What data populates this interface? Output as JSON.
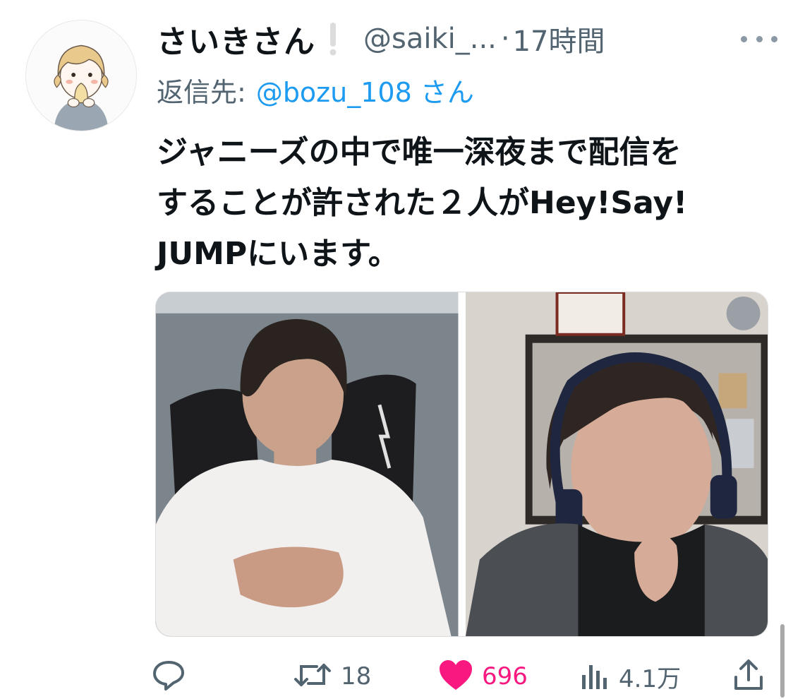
{
  "tweet": {
    "author_name": "さいきさん",
    "handle": "@saiki_...",
    "separator": "·",
    "time": "17時間",
    "reply_prefix": "返信先:",
    "reply_mention": "@bozu_108 さん",
    "text_lines": [
      "ジャニーズの中で唯一深夜まで配信を",
      "することが許された２人がHey!Say!",
      "JUMPにいます。"
    ]
  },
  "actions": {
    "replies": "",
    "retweets": "18",
    "likes": "696",
    "views": "4.1万",
    "liked": true
  },
  "colors": {
    "accent": "#1d9bf0",
    "like": "#f91880",
    "secondary_text": "#536471"
  },
  "icons": [
    "avatar-illustration",
    "exclamation-icon",
    "more-icon",
    "reply-icon",
    "retweet-icon",
    "heart-icon",
    "views-icon",
    "share-icon"
  ]
}
